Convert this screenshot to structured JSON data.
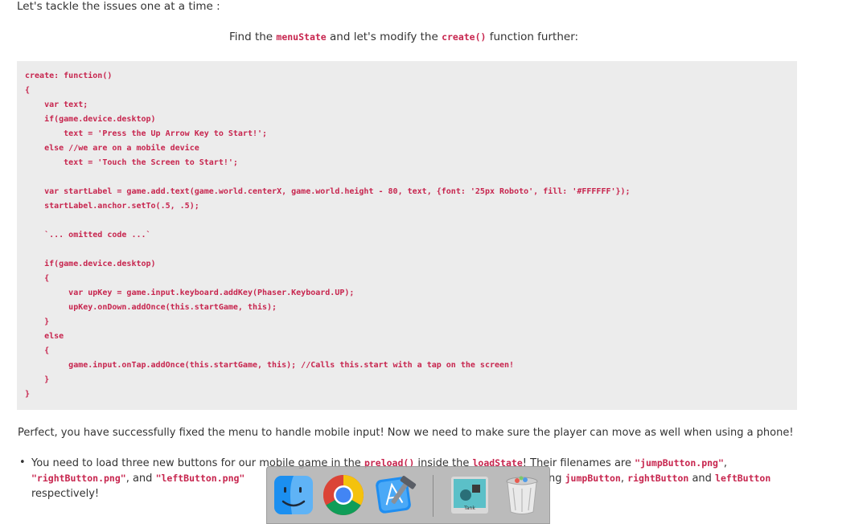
{
  "intro": "Let's tackle the issues one at a time :",
  "find_line": {
    "prefix": "Find the ",
    "menu_state": "menuState",
    "middle": " and let's modify the ",
    "create_fn": "create()",
    "suffix": " function further:"
  },
  "code_lines": [
    "create: function()",
    "{",
    "    var text;",
    "    if(game.device.desktop)",
    "        text = 'Press the Up Arrow Key to Start!';",
    "    else //we are on a mobile device",
    "        text = 'Touch the Screen to Start!';",
    "    var startLabel = game.add.text(game.world.centerX, game.world.height - 80, text, {font: '25px Roboto', fill: '#FFFFFF'});",
    "    startLabel.anchor.setTo(.5, .5);",
    "    `... omitted code ...`",
    "    if(game.device.desktop)",
    "    {",
    "         var upKey = game.input.keyboard.addKey(Phaser.Keyboard.UP);",
    "         upKey.onDown.addOnce(this.startGame, this);",
    "    }",
    "    else",
    "    {",
    "         game.input.onTap.addOnce(this.startGame, this); //Calls this.start with a tap on the screen!",
    "    }",
    "}"
  ],
  "perfect_text": "Perfect, you have successfully fixed the menu to handle mobile input! Now we need to make sure the player can move as well when using a phone!",
  "bullet": {
    "dot": "•",
    "l1_a": "You need to load three new buttons for our ",
    "l1_b": "mobile game in the ",
    "l1_preload": "preload()",
    "l1_c": " inside the ",
    "l1_loadstate": "loadState",
    "l1_d": "! Their filenames are ",
    "l1_jump_png": "\"jumpButton.png\"",
    "l1_e": ",",
    "l2_right_png": "\"rightButton.png\"",
    "l2_a": ", and ",
    "l2_left_png": "\"leftButton.png\"",
    "l2_b": "ng ",
    "l2_jump": "jumpButton",
    "l2_c": ", ",
    "l2_right": "rightButton",
    "l2_d": " and ",
    "l2_left": "leftButton",
    "l3": "respectively!"
  },
  "dock": {
    "items": [
      "finder-icon",
      "chrome-icon",
      "xcode-icon",
      "preview-icon",
      "trash-icon"
    ],
    "preview_label": "Tank"
  }
}
